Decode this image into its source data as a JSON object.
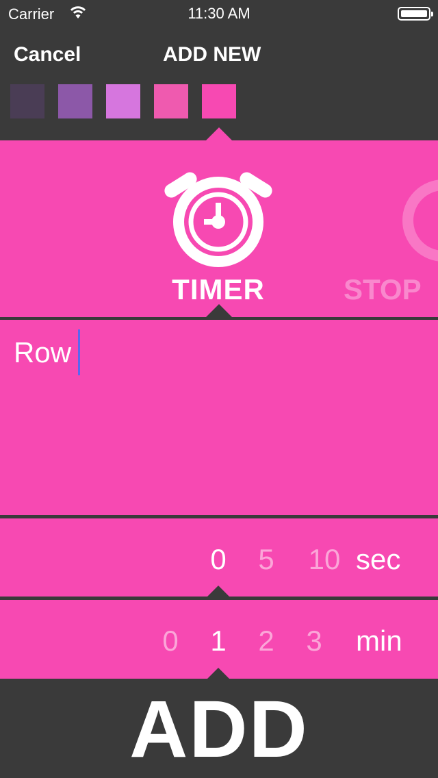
{
  "status_bar": {
    "carrier": "Carrier",
    "time": "11:30 AM"
  },
  "header": {
    "cancel_label": "Cancel",
    "title": "ADD NEW"
  },
  "color_swatches": [
    "#4a3d55",
    "#8c58a8",
    "#d676de",
    "#ef5aaf",
    "#f749b2"
  ],
  "selected_swatch": 4,
  "icons": {
    "selected_label": "TIMER",
    "next_label": "STOP"
  },
  "name_input": {
    "value": "Row"
  },
  "seconds_picker": {
    "values": [
      "0",
      "5",
      "10"
    ],
    "selected": "0",
    "unit": "sec"
  },
  "minutes_picker": {
    "values": [
      "0",
      "1",
      "2",
      "3"
    ],
    "selected": "1",
    "unit": "min"
  },
  "add_label": "ADD",
  "colors": {
    "accent": "#f749b2",
    "background": "#3a3a3a",
    "cursor": "#5a67f0"
  }
}
